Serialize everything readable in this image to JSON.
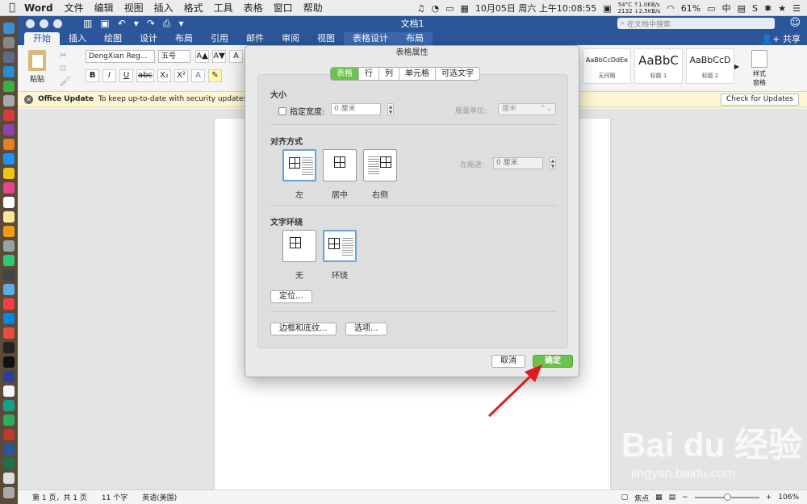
{
  "menubar": {
    "app": "Word",
    "items": [
      "文件",
      "编辑",
      "视图",
      "插入",
      "格式",
      "工具",
      "表格",
      "窗口",
      "帮助"
    ],
    "temp": "54°C",
    "net_up": "↑1.0KB/s",
    "rpm": "2132",
    "net_down": "↓2.5KB/s",
    "datetime": "10月05日 周六 上午10:08:55",
    "battery": "61%",
    "ime": "中"
  },
  "titlebar": {
    "doc_title": "文档1",
    "search_placeholder": "在文档中搜索"
  },
  "tabs": [
    {
      "label": "开始",
      "state": "active"
    },
    {
      "label": "插入"
    },
    {
      "label": "绘图"
    },
    {
      "label": "设计"
    },
    {
      "label": "布局"
    },
    {
      "label": "引用"
    },
    {
      "label": "邮件"
    },
    {
      "label": "审阅"
    },
    {
      "label": "视图"
    },
    {
      "label": "表格设计",
      "state": "context"
    },
    {
      "label": "布局"
    }
  ],
  "share_label": "共享",
  "ribbon": {
    "paste_label": "粘贴",
    "font_name": "DengXian Reg...",
    "font_size": "五号",
    "grow": "A▲",
    "shrink": "A▼",
    "bold": "B",
    "italic": "I",
    "underline": "U",
    "strike": "abc",
    "sub": "X₂",
    "sup": "X²",
    "styles": [
      {
        "sample": "AaBbCcDdEe",
        "name": "无间隔"
      },
      {
        "sample": "AaBbC",
        "name": "标题 1"
      },
      {
        "sample": "AaBbCcD",
        "name": "标题 2"
      }
    ],
    "style_pane_label": "样式\n窗格"
  },
  "notice": {
    "title": "Office Update",
    "message": "To keep up-to-date with security updates, fix",
    "button": "Check for Updates"
  },
  "dialog": {
    "title": "表格属性",
    "segments": [
      "表格",
      "行",
      "列",
      "单元格",
      "可选文字"
    ],
    "size_section": "大小",
    "preferred_width_label": "指定宽度:",
    "preferred_width_value": "0 厘米",
    "measure_label": "度量单位:",
    "measure_value": "厘米",
    "align_section": "对齐方式",
    "align_options": [
      "左",
      "居中",
      "右侧"
    ],
    "indent_label": "左缩进:",
    "indent_value": "0 厘米",
    "wrap_section": "文字环绕",
    "wrap_options": [
      "无",
      "环绕"
    ],
    "position_button": "定位...",
    "borders_button": "边框和底纹...",
    "options_button": "选项...",
    "cancel_button": "取消",
    "ok_button": "确定"
  },
  "statusbar": {
    "page": "第 1 页，共 1 页",
    "words": "11 个字",
    "language": "英语(美国)",
    "focus": "焦点",
    "zoom": "106%"
  },
  "watermark": {
    "brand": "Bai du 经验",
    "url": "jingyan.baidu.com"
  },
  "colors": {
    "word_blue": "#2b579a",
    "ok_green": "#6cc24a",
    "arrow_red": "#e0191e"
  }
}
